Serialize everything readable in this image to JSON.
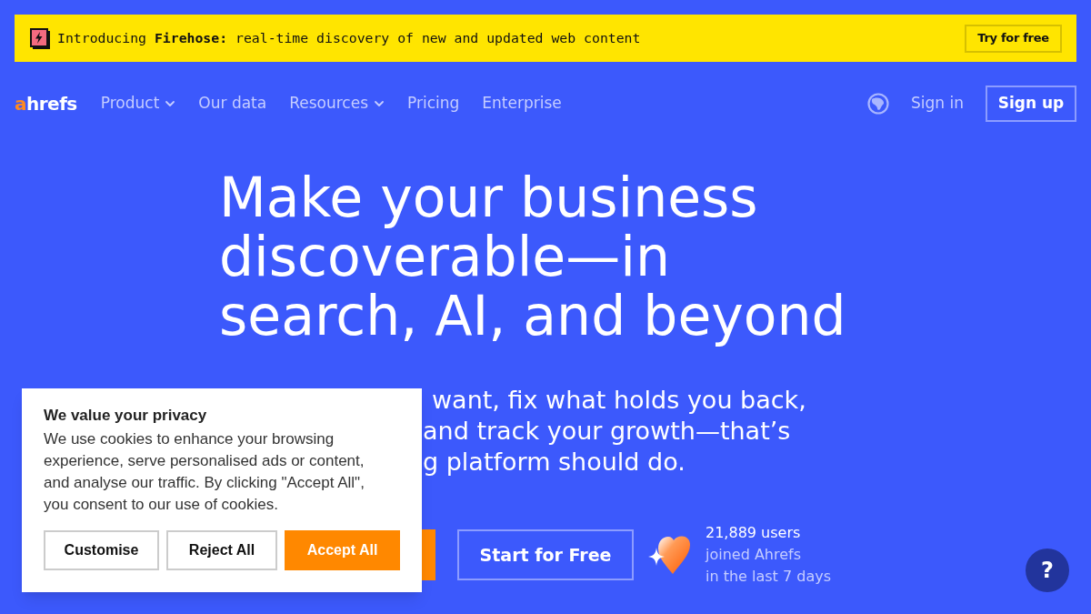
{
  "announcement": {
    "text": "Introducing **Firehose:** real-time discovery of new and updated web content",
    "button": "Try for free"
  },
  "nav": {
    "logo": "ahrefs",
    "items": [
      {
        "label": "Product",
        "dropdown": true
      },
      {
        "label": "Our data",
        "dropdown": false
      },
      {
        "label": "Resources",
        "dropdown": true
      },
      {
        "label": "Pricing",
        "dropdown": false
      },
      {
        "label": "Enterprise",
        "dropdown": false
      }
    ],
    "sign_in": "Sign in",
    "sign_up": "Sign up"
  },
  "hero": {
    "title": "Make your business discoverable—in search, AI, and beyond",
    "subtitle_lines": [
      "want, fix what holds you back,",
      "and track your growth—that’s",
      "g platform should do."
    ],
    "secondary_button": "Start for Free",
    "social_proof": {
      "count": "21,889 users",
      "lines": [
        "joined Ahrefs",
        "in the last 7 days"
      ]
    }
  },
  "cookie_banner": {
    "title": "We value your privacy",
    "text": "We use cookies to enhance your browsing experience, serve personalised ads or content, and analyse our traffic. By clicking \"Accept All\", you consent to our use of cookies.",
    "buttons": [
      {
        "label": "Customise",
        "kind": "outline"
      },
      {
        "label": "Reject All",
        "kind": "outline"
      },
      {
        "label": "Accept All",
        "kind": "primary"
      }
    ]
  },
  "help_button": {
    "label": "?"
  }
}
